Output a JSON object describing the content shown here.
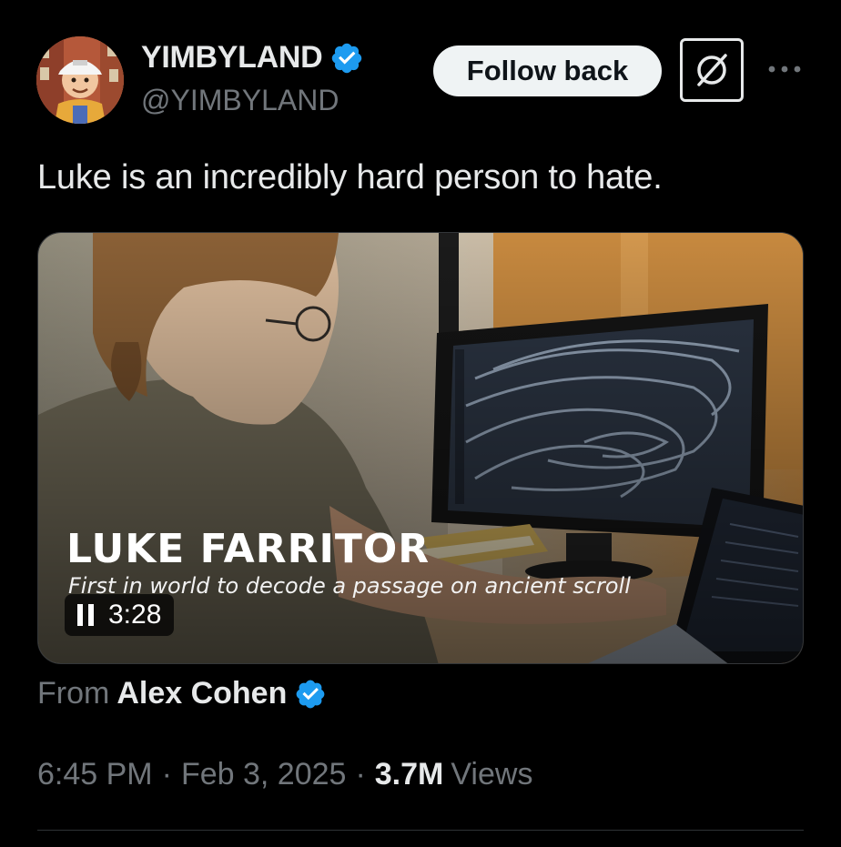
{
  "author": {
    "display_name": "YIMBYLAND",
    "handle": "@YIMBYLAND",
    "verified": true
  },
  "actions": {
    "follow_label": "Follow back"
  },
  "tweet": {
    "text": "Luke is an incredibly hard person to hate."
  },
  "media": {
    "overlay_title": "LUKE FARRITOR",
    "overlay_subtitle": "First in world to decode a passage on ancient scroll",
    "duration": "3:28",
    "state": "playing"
  },
  "attribution": {
    "from_label": "From",
    "from_name": "Alex Cohen",
    "verified": true
  },
  "meta": {
    "time": "6:45 PM",
    "date": "Feb 3, 2025",
    "views_count": "3.7M",
    "views_label": "Views",
    "separator": "·"
  },
  "colors": {
    "background": "#000000",
    "primary_text": "#e7e9ea",
    "secondary_text": "#71767b",
    "verified_blue": "#1d9bf0",
    "follow_button_bg": "#eff3f4"
  },
  "icons": {
    "verified": "verified-badge-icon",
    "grok": "grok-icon",
    "more": "more-horizontal-icon",
    "pause": "pause-icon"
  }
}
